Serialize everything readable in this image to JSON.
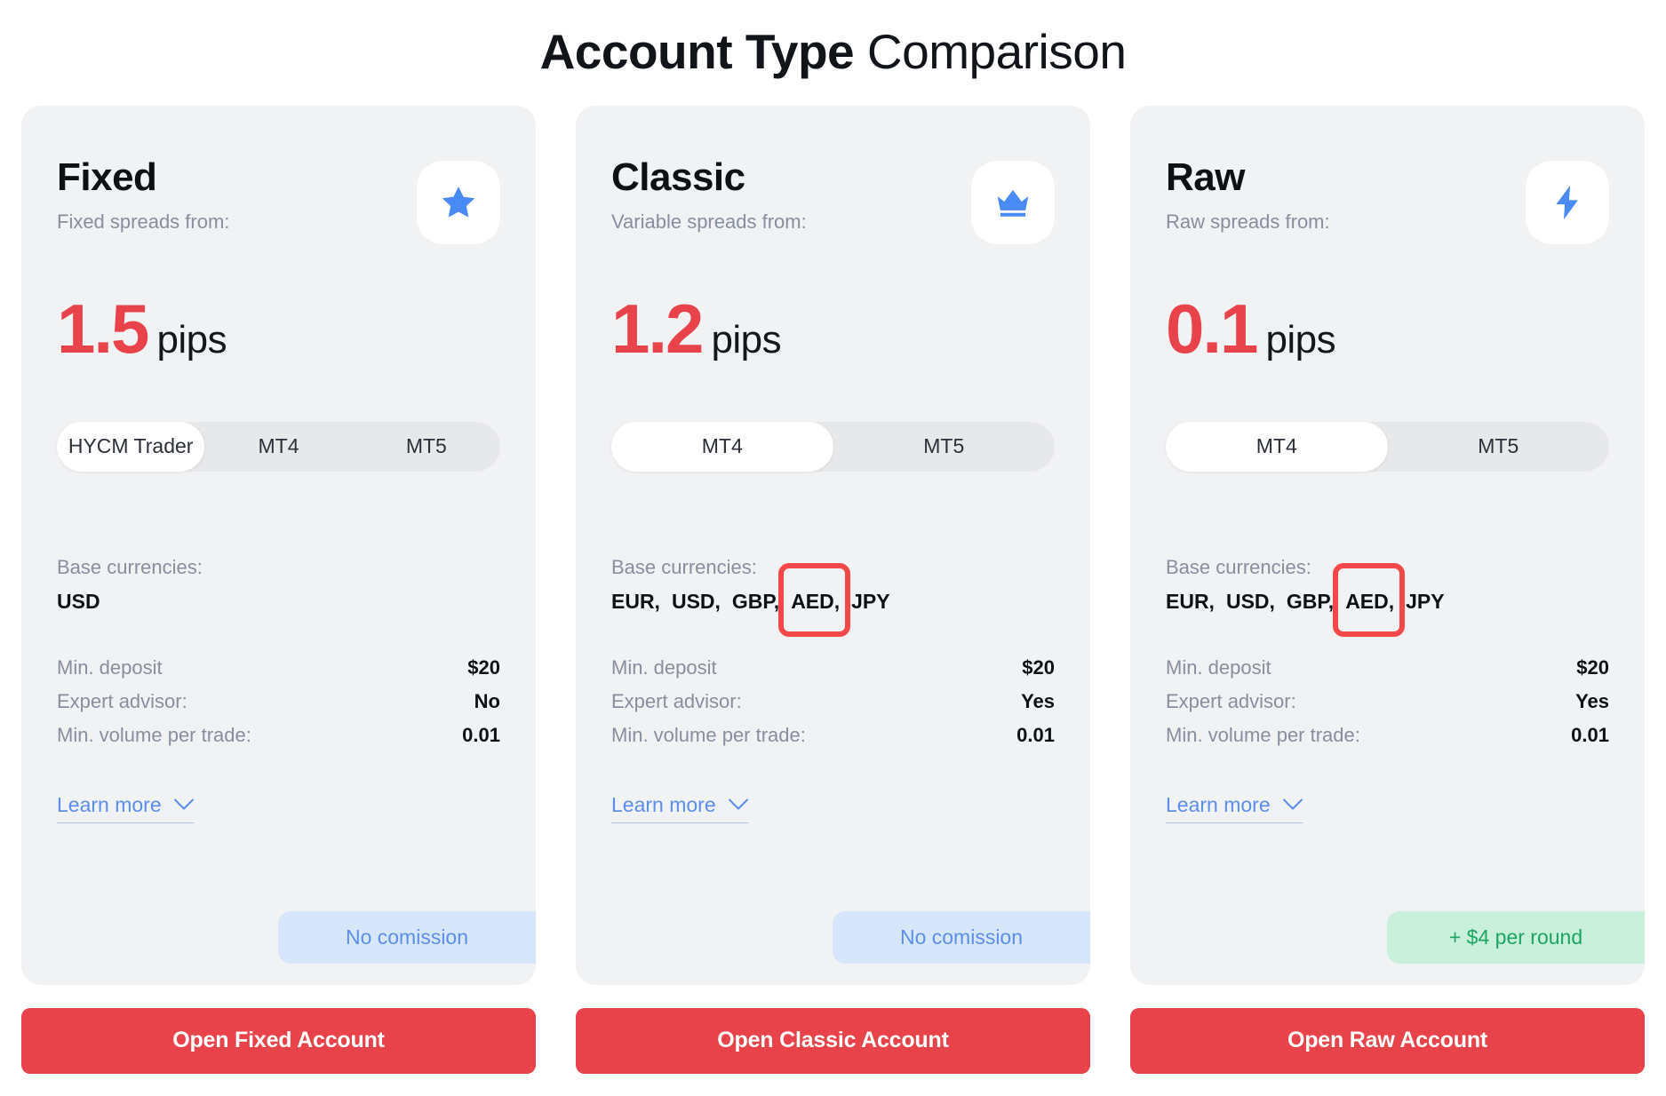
{
  "header": {
    "title_strong": "Account Type",
    "title_rest": " Comparison"
  },
  "colors": {
    "accent_red": "#e8434a",
    "annotation_red": "#f2484a",
    "link_blue": "#5b8dea",
    "icon_blue": "#4a8af4",
    "card_bg": "#f1f2f4",
    "badge_blue_bg": "#d8e6fb",
    "badge_green_bg": "#c9f0da",
    "badge_green_text": "#1da462",
    "muted_text": "#878e9d"
  },
  "labels": {
    "base_currencies": "Base currencies:",
    "min_deposit": "Min. deposit",
    "expert_advisor": "Expert advisor:",
    "min_volume": "Min. volume per trade:",
    "learn_more": "Learn more",
    "pips": "pips"
  },
  "cards": [
    {
      "name": "Fixed",
      "icon": "star-icon",
      "subtitle": "Fixed spreads from:",
      "spread_value": "1.5",
      "spread_unit": "pips",
      "platforms": [
        "HYCM Trader",
        "MT4",
        "MT5"
      ],
      "active_platform": "HYCM Trader",
      "currencies": [
        "USD"
      ],
      "specs": [
        {
          "label": "Min. deposit",
          "value": "$20"
        },
        {
          "label": "Expert advisor:",
          "value": "No"
        },
        {
          "label": "Min. volume per trade:",
          "value": "0.01"
        }
      ],
      "learn_more": "Learn more",
      "commission": "No comission",
      "commission_style": "blue",
      "cta": "Open Fixed Account",
      "annotated_currency": null
    },
    {
      "name": "Classic",
      "icon": "crown-icon",
      "subtitle": "Variable spreads from:",
      "spread_value": "1.2",
      "spread_unit": "pips",
      "platforms": [
        "MT4",
        "MT5"
      ],
      "active_platform": "MT4",
      "currencies": [
        "EUR,",
        "USD,",
        "GBP,",
        "AED,",
        "JPY"
      ],
      "specs": [
        {
          "label": "Min. deposit",
          "value": "$20"
        },
        {
          "label": "Expert advisor:",
          "value": "Yes"
        },
        {
          "label": "Min. volume per trade:",
          "value": "0.01"
        }
      ],
      "learn_more": "Learn more",
      "commission": "No comission",
      "commission_style": "blue",
      "cta": "Open Classic Account",
      "annotated_currency": "AED,"
    },
    {
      "name": "Raw",
      "icon": "lightning-icon",
      "subtitle": "Raw spreads from:",
      "spread_value": "0.1",
      "spread_unit": "pips",
      "platforms": [
        "MT4",
        "MT5"
      ],
      "active_platform": "MT4",
      "currencies": [
        "EUR,",
        "USD,",
        "GBP,",
        "AED,",
        "JPY"
      ],
      "specs": [
        {
          "label": "Min. deposit",
          "value": "$20"
        },
        {
          "label": "Expert advisor:",
          "value": "Yes"
        },
        {
          "label": "Min. volume per trade:",
          "value": "0.01"
        }
      ],
      "learn_more": "Learn more",
      "commission": "+ $4 per round",
      "commission_style": "green",
      "cta": "Open Raw Account",
      "annotated_currency": "AED,"
    }
  ],
  "annotations": [
    {
      "target": "classic-currency-aed",
      "shape": "rounded-rect",
      "color": "#f2484a"
    },
    {
      "target": "raw-currency-aed",
      "shape": "rounded-rect",
      "color": "#f2484a"
    }
  ]
}
